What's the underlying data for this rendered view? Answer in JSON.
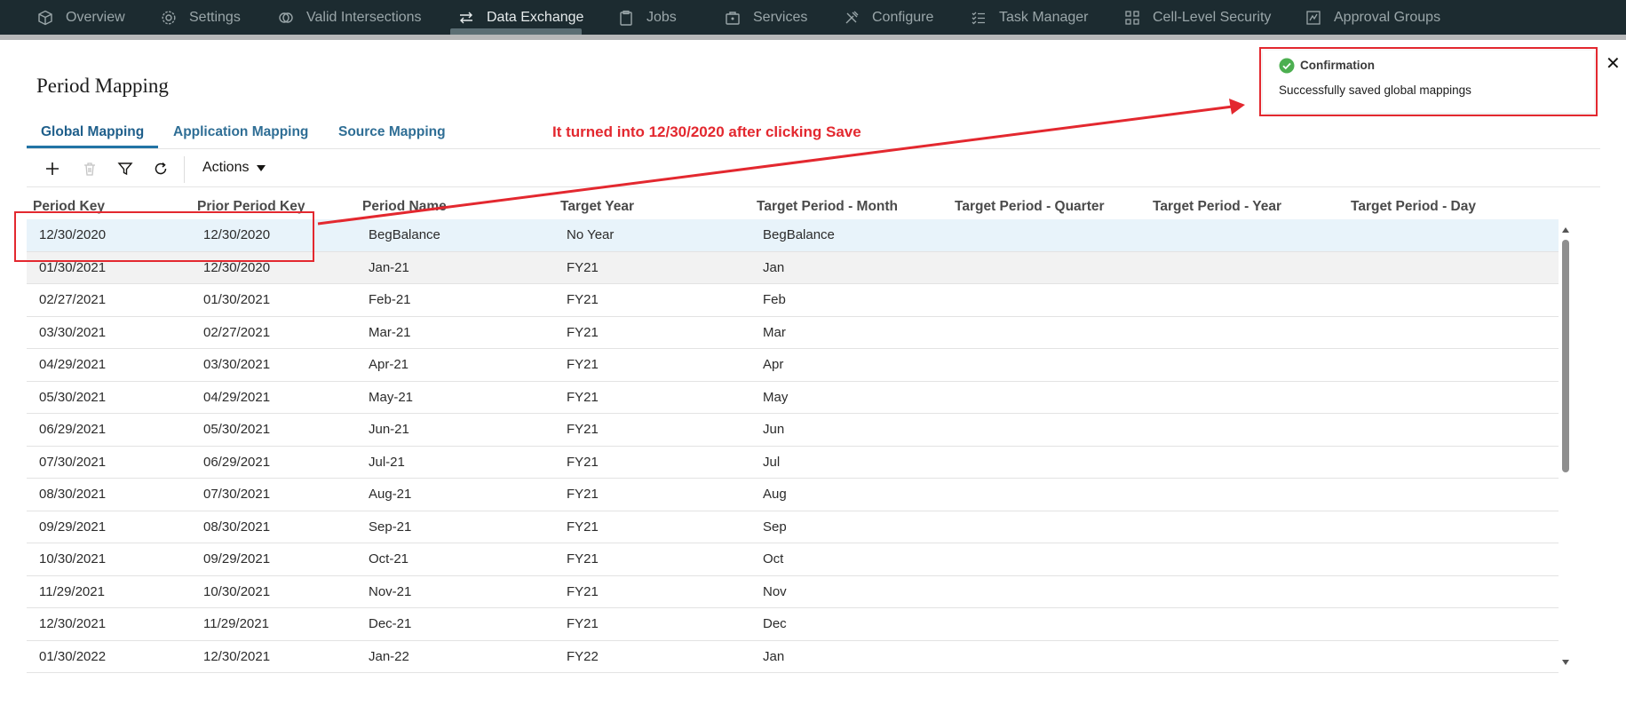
{
  "nav": {
    "items": [
      {
        "label": "Overview",
        "icon": "cube-icon"
      },
      {
        "label": "Settings",
        "icon": "gear-icon"
      },
      {
        "label": "Valid Intersections",
        "icon": "intersect-icon"
      },
      {
        "label": "Data Exchange",
        "icon": "exchange-arrows-icon",
        "active": true
      },
      {
        "label": "Jobs",
        "icon": "clipboard-icon"
      },
      {
        "label": "Services",
        "icon": "briefcase-icon"
      },
      {
        "label": "Configure",
        "icon": "tools-icon"
      },
      {
        "label": "Task Manager",
        "icon": "checklist-icon"
      },
      {
        "label": "Cell-Level Security",
        "icon": "grid-lock-icon"
      },
      {
        "label": "Approval Groups",
        "icon": "approval-icon"
      }
    ]
  },
  "page": {
    "title": "Period Mapping"
  },
  "tabs": [
    {
      "label": "Global Mapping",
      "active": true
    },
    {
      "label": "Application Mapping"
    },
    {
      "label": "Source Mapping"
    }
  ],
  "annotation": {
    "text": "It turned into 12/30/2020 after clicking Save"
  },
  "toolbar": {
    "add_icon": "plus-icon",
    "delete_icon": "trash-icon",
    "filter_icon": "filter-icon",
    "refresh_icon": "refresh-icon",
    "actions_label": "Actions"
  },
  "table": {
    "columns": [
      "Period Key",
      "Prior Period Key",
      "Period Name",
      "Target Year",
      "Target Period - Month",
      "Target Period - Quarter",
      "Target Period - Year",
      "Target Period - Day"
    ],
    "rows": [
      [
        "12/30/2020",
        "12/30/2020",
        "BegBalance",
        "No Year",
        "BegBalance",
        "",
        "",
        ""
      ],
      [
        "01/30/2021",
        "12/30/2020",
        "Jan-21",
        "FY21",
        "Jan",
        "",
        "",
        ""
      ],
      [
        "02/27/2021",
        "01/30/2021",
        "Feb-21",
        "FY21",
        "Feb",
        "",
        "",
        ""
      ],
      [
        "03/30/2021",
        "02/27/2021",
        "Mar-21",
        "FY21",
        "Mar",
        "",
        "",
        ""
      ],
      [
        "04/29/2021",
        "03/30/2021",
        "Apr-21",
        "FY21",
        "Apr",
        "",
        "",
        ""
      ],
      [
        "05/30/2021",
        "04/29/2021",
        "May-21",
        "FY21",
        "May",
        "",
        "",
        ""
      ],
      [
        "06/29/2021",
        "05/30/2021",
        "Jun-21",
        "FY21",
        "Jun",
        "",
        "",
        ""
      ],
      [
        "07/30/2021",
        "06/29/2021",
        "Jul-21",
        "FY21",
        "Jul",
        "",
        "",
        ""
      ],
      [
        "08/30/2021",
        "07/30/2021",
        "Aug-21",
        "FY21",
        "Aug",
        "",
        "",
        ""
      ],
      [
        "09/29/2021",
        "08/30/2021",
        "Sep-21",
        "FY21",
        "Sep",
        "",
        "",
        ""
      ],
      [
        "10/30/2021",
        "09/29/2021",
        "Oct-21",
        "FY21",
        "Oct",
        "",
        "",
        ""
      ],
      [
        "11/29/2021",
        "10/30/2021",
        "Nov-21",
        "FY21",
        "Nov",
        "",
        "",
        ""
      ],
      [
        "12/30/2021",
        "11/29/2021",
        "Dec-21",
        "FY21",
        "Dec",
        "",
        "",
        ""
      ],
      [
        "01/30/2022",
        "12/30/2021",
        "Jan-22",
        "FY22",
        "Jan",
        "",
        "",
        ""
      ]
    ]
  },
  "toast": {
    "title": "Confirmation",
    "message": "Successfully saved global mappings",
    "icon": "check-circle-icon",
    "close": "✕"
  },
  "colors": {
    "nav_bg": "#1c2b30",
    "link_blue": "#2274a5",
    "annotation_red": "#e3282f",
    "selected_row": "#e8f3fa",
    "success_green": "#4caf50"
  }
}
